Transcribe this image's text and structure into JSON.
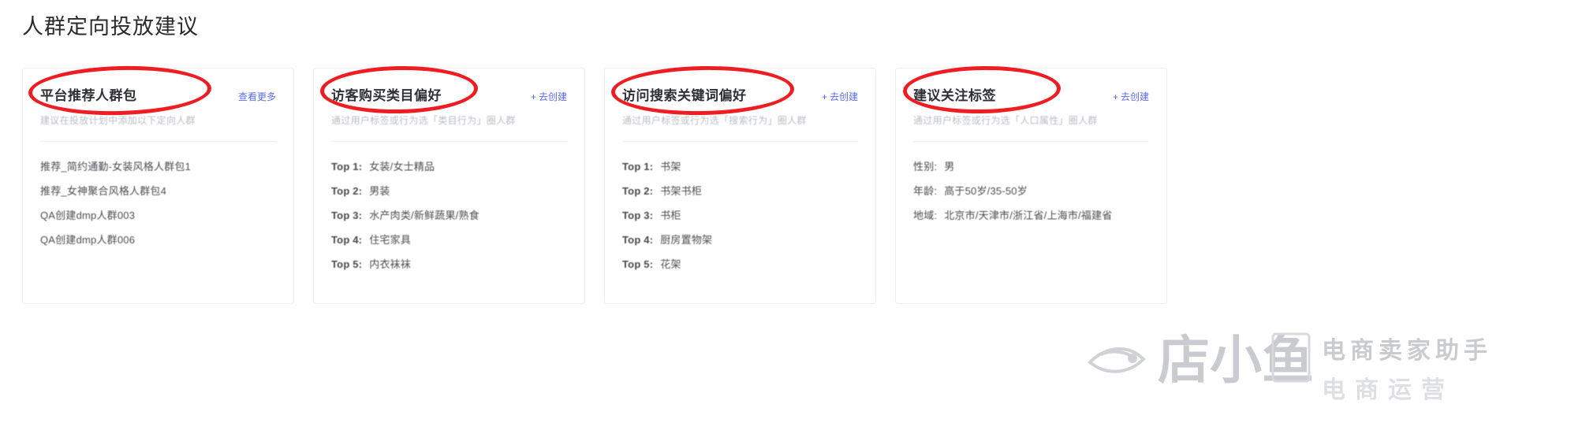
{
  "page": {
    "title": "人群定向投放建议"
  },
  "cards": [
    {
      "title": "平台推荐人群包",
      "action_label": "查看更多",
      "action_has_plus": false,
      "subtitle": "建议在投放计划中添加以下定向人群",
      "items": [
        {
          "key": "",
          "value": "推荐_简约通勤-女装风格人群包1"
        },
        {
          "key": "",
          "value": "推荐_女神聚合风格人群包4"
        },
        {
          "key": "",
          "value": "QA创建dmp人群003"
        },
        {
          "key": "",
          "value": "QA创建dmp人群006"
        }
      ]
    },
    {
      "title": "访客购买类目偏好",
      "action_label": "去创建",
      "action_has_plus": true,
      "subtitle": "通过用户标签或行为选「类目行为」圈人群",
      "items": [
        {
          "key": "Top 1:",
          "value": "女装/女士精品"
        },
        {
          "key": "Top 2:",
          "value": "男装"
        },
        {
          "key": "Top 3:",
          "value": "水产肉类/新鲜蔬果/熟食"
        },
        {
          "key": "Top 4:",
          "value": "住宅家具"
        },
        {
          "key": "Top 5:",
          "value": "内衣袜袜"
        }
      ]
    },
    {
      "title": "访问搜索关键词偏好",
      "action_label": "去创建",
      "action_has_plus": true,
      "subtitle": "通过用户标签或行为选「搜索行为」圈人群",
      "items": [
        {
          "key": "Top 1:",
          "value": "书架"
        },
        {
          "key": "Top 2:",
          "value": "书架书柜"
        },
        {
          "key": "Top 3:",
          "value": "书柜"
        },
        {
          "key": "Top 4:",
          "value": "厨房置物架"
        },
        {
          "key": "Top 5:",
          "value": "花架"
        }
      ]
    },
    {
      "title": "建议关注标签",
      "action_label": "去创建",
      "action_has_plus": true,
      "subtitle": "通过用户标签或行为选「人口属性」圈人群",
      "items": [
        {
          "key": "性别:",
          "value": "男"
        },
        {
          "key": "年龄:",
          "value": "高于50岁/35-50岁"
        },
        {
          "key": "地域:",
          "value": "北京市/天津市/浙江省/上海市/福建省"
        }
      ]
    }
  ],
  "watermark": {
    "brand": "店小鱼",
    "tagline_top": "电商卖家助手",
    "tagline_bottom": "电商运营"
  },
  "colors": {
    "link": "#5b6ef0",
    "annotation": "#ef1c22",
    "title": "#2b2b2b",
    "muted": "#b9bcc4"
  },
  "annotations": {
    "count": 4,
    "shape": "ellipse",
    "color": "#ef1c22"
  }
}
